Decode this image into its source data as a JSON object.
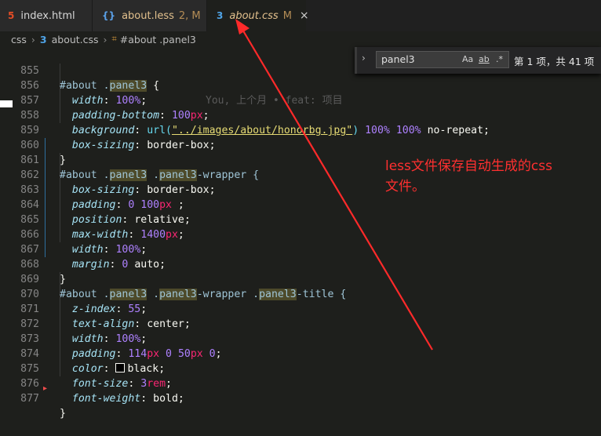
{
  "tabs": [
    {
      "icon": "5",
      "label": "index.html",
      "status": "",
      "close": ""
    },
    {
      "icon": "{}",
      "label": "about.less",
      "status": "2, M",
      "close": ""
    },
    {
      "icon": "3",
      "label": "about.css",
      "status": "M",
      "close": "×"
    }
  ],
  "breadcrumb": {
    "folder": "css",
    "file": "about.css",
    "symbol": "#about .panel3"
  },
  "find": {
    "query": "panel3",
    "opt_case": "Aa",
    "opt_word": "ab",
    "opt_regex": ".*",
    "count": "第 1 项，共 41 项"
  },
  "blame": "You, 上个月 • feat: 项目",
  "annotation": {
    "line1": "less文件保存自动生成的css",
    "line2": "文件。"
  },
  "lines": [
    {
      "n": "855"
    },
    {
      "n": "856"
    },
    {
      "n": "857"
    },
    {
      "n": "858"
    },
    {
      "n": "859"
    },
    {
      "n": "860"
    },
    {
      "n": "861"
    },
    {
      "n": "862"
    },
    {
      "n": "863"
    },
    {
      "n": "864"
    },
    {
      "n": "865"
    },
    {
      "n": "866"
    },
    {
      "n": "867"
    },
    {
      "n": "868"
    },
    {
      "n": "869"
    },
    {
      "n": "870"
    },
    {
      "n": "871"
    },
    {
      "n": "872"
    },
    {
      "n": "873"
    },
    {
      "n": "874"
    },
    {
      "n": "875"
    },
    {
      "n": "876"
    },
    {
      "n": "877"
    }
  ],
  "code": {
    "l855": {
      "sel": "#about .",
      "match": "panel3",
      "rest": " {"
    },
    "l856": {
      "prop": "width",
      "val": "100",
      "unit": "%"
    },
    "l857": {
      "prop": "padding-bottom",
      "val": "100",
      "unit": "px"
    },
    "l858": {
      "prop": "background",
      "fn": "url(",
      "str": "\"../images/about/honorbg.jpg\"",
      "close": ")",
      "v1": "100",
      "v2": "100",
      "unit": "%",
      "kw": "no-repeat"
    },
    "l859": {
      "prop": "box-sizing",
      "kw": "border-box"
    },
    "l860": {
      "brace": "}"
    },
    "l861": {
      "sel": "#about .",
      "match": "panel3",
      "mid": " .",
      "match2": "panel3",
      "rest": "-wrapper {"
    },
    "l862": {
      "prop": "box-sizing",
      "kw": "border-box"
    },
    "l863": {
      "prop": "padding",
      "v1": "0",
      "v2": "100",
      "unit": "px",
      "tail": " ;"
    },
    "l864": {
      "prop": "position",
      "kw": "relative"
    },
    "l865": {
      "prop": "max-width",
      "val": "1400",
      "unit": "px"
    },
    "l866": {
      "prop": "width",
      "val": "100",
      "unit": "%"
    },
    "l867": {
      "prop": "margin",
      "v1": "0",
      "kw": "auto"
    },
    "l868": {
      "brace": "}"
    },
    "l869": {
      "sel": "#about .",
      "match": "panel3",
      "mid": " .",
      "match2": "panel3",
      "mid2": "-wrapper .",
      "match3": "panel3",
      "rest": "-title {"
    },
    "l870": {
      "prop": "z-index",
      "val": "55"
    },
    "l871": {
      "prop": "text-align",
      "kw": "center"
    },
    "l872": {
      "prop": "width",
      "val": "100",
      "unit": "%"
    },
    "l873": {
      "prop": "padding",
      "v1": "114",
      "v2": "0",
      "v3": "50",
      "v4": "0",
      "unit": "px"
    },
    "l874": {
      "prop": "color",
      "kw": "black"
    },
    "l875": {
      "prop": "font-size",
      "val": "3",
      "unit": "rem"
    },
    "l876": {
      "prop": "font-weight",
      "kw": "bold"
    },
    "l877": {
      "brace": "}"
    }
  },
  "colors": {
    "background": "#1e1f1c",
    "annotation": "#ff3030",
    "number": "#ae81ff",
    "unit": "#f92672",
    "string": "#e6db74"
  }
}
